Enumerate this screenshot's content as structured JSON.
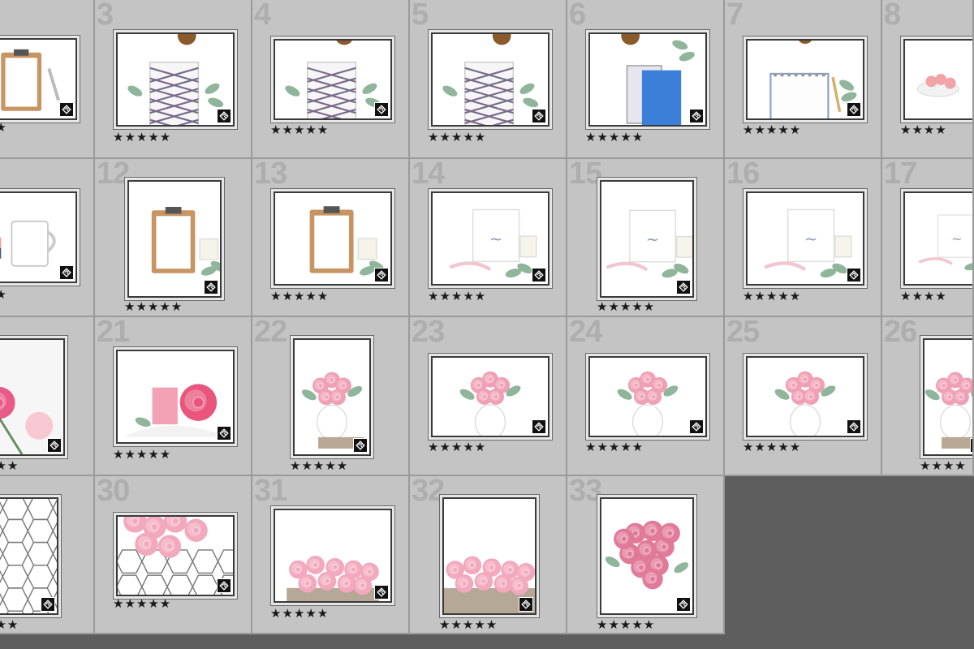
{
  "grid": {
    "empty_area_color": "#5e5e5e",
    "cell_color": "#c4c4c4",
    "cells": [
      {
        "number": "",
        "rating": "★★",
        "photo": "clipboard-pen",
        "color": "#c89462"
      },
      {
        "number": "3",
        "rating": "★★★★★",
        "photo": "plaid-notebook-coffee",
        "color": "#7a6a8a"
      },
      {
        "number": "4",
        "rating": "★★★★★",
        "photo": "plaid-notebook-coffee",
        "color": "#7a6a8a"
      },
      {
        "number": "5",
        "rating": "★★★★★",
        "photo": "plaid-notebook-coffee",
        "color": "#7a6a8a"
      },
      {
        "number": "6",
        "rating": "★★★★★",
        "photo": "blue-notebook",
        "color": "#3b7fd8"
      },
      {
        "number": "7",
        "rating": "★★★★★",
        "photo": "spiral-notebook",
        "color": "#8aa0c4"
      },
      {
        "number": "8",
        "rating": "★★★★",
        "photo": "macarons",
        "color": "#f2a3a8"
      },
      {
        "number": "",
        "rating": "★★",
        "photo": "mug-books",
        "color": "#e9a38a"
      },
      {
        "number": "12",
        "rating": "★★★★★",
        "photo": "clipboard-candle",
        "color": "#c89462"
      },
      {
        "number": "13",
        "rating": "★★★★★",
        "photo": "clipboard-candle",
        "color": "#c89462"
      },
      {
        "number": "14",
        "rating": "★★★★★",
        "photo": "love-sign",
        "color": "#b8bcc8"
      },
      {
        "number": "15",
        "rating": "★★★★★",
        "photo": "love-sign",
        "color": "#b8bcc8"
      },
      {
        "number": "16",
        "rating": "★★★★★",
        "photo": "love-sign",
        "color": "#b8bcc8"
      },
      {
        "number": "17",
        "rating": "★★★★",
        "photo": "love-sign",
        "color": "#b8bcc8"
      },
      {
        "number": "",
        "rating": "★★★",
        "photo": "pink-roses-stems",
        "color": "#e85a88"
      },
      {
        "number": "21",
        "rating": "★★★★★",
        "photo": "pink-candle-rose",
        "color": "#e8567e"
      },
      {
        "number": "22",
        "rating": "★★★★★",
        "photo": "vase-roses",
        "color": "#f0a0b4"
      },
      {
        "number": "23",
        "rating": "★★★★★",
        "photo": "vase-roses",
        "color": "#f0a0b4"
      },
      {
        "number": "24",
        "rating": "★★★★★",
        "photo": "vase-roses",
        "color": "#f0a0b4"
      },
      {
        "number": "25",
        "rating": "★★★★★",
        "photo": "vase-roses",
        "color": "#f0a0b4"
      },
      {
        "number": "26",
        "rating": "★★★★",
        "photo": "vase-roses",
        "color": "#f0a0b4"
      },
      {
        "number": "",
        "rating": "★★★",
        "photo": "tile-pattern",
        "color": "#777777"
      },
      {
        "number": "30",
        "rating": "★★★★★",
        "photo": "roses-on-tile",
        "color": "#f3a9bd"
      },
      {
        "number": "31",
        "rating": "★★★★★",
        "photo": "roses-on-wood",
        "color": "#f3a9bd"
      },
      {
        "number": "32",
        "rating": "★★★★★",
        "photo": "roses-on-wood",
        "color": "#f3a9bd"
      },
      {
        "number": "33",
        "rating": "★★★★★",
        "photo": "rose-bouquet",
        "color": "#e07a98"
      }
    ]
  }
}
